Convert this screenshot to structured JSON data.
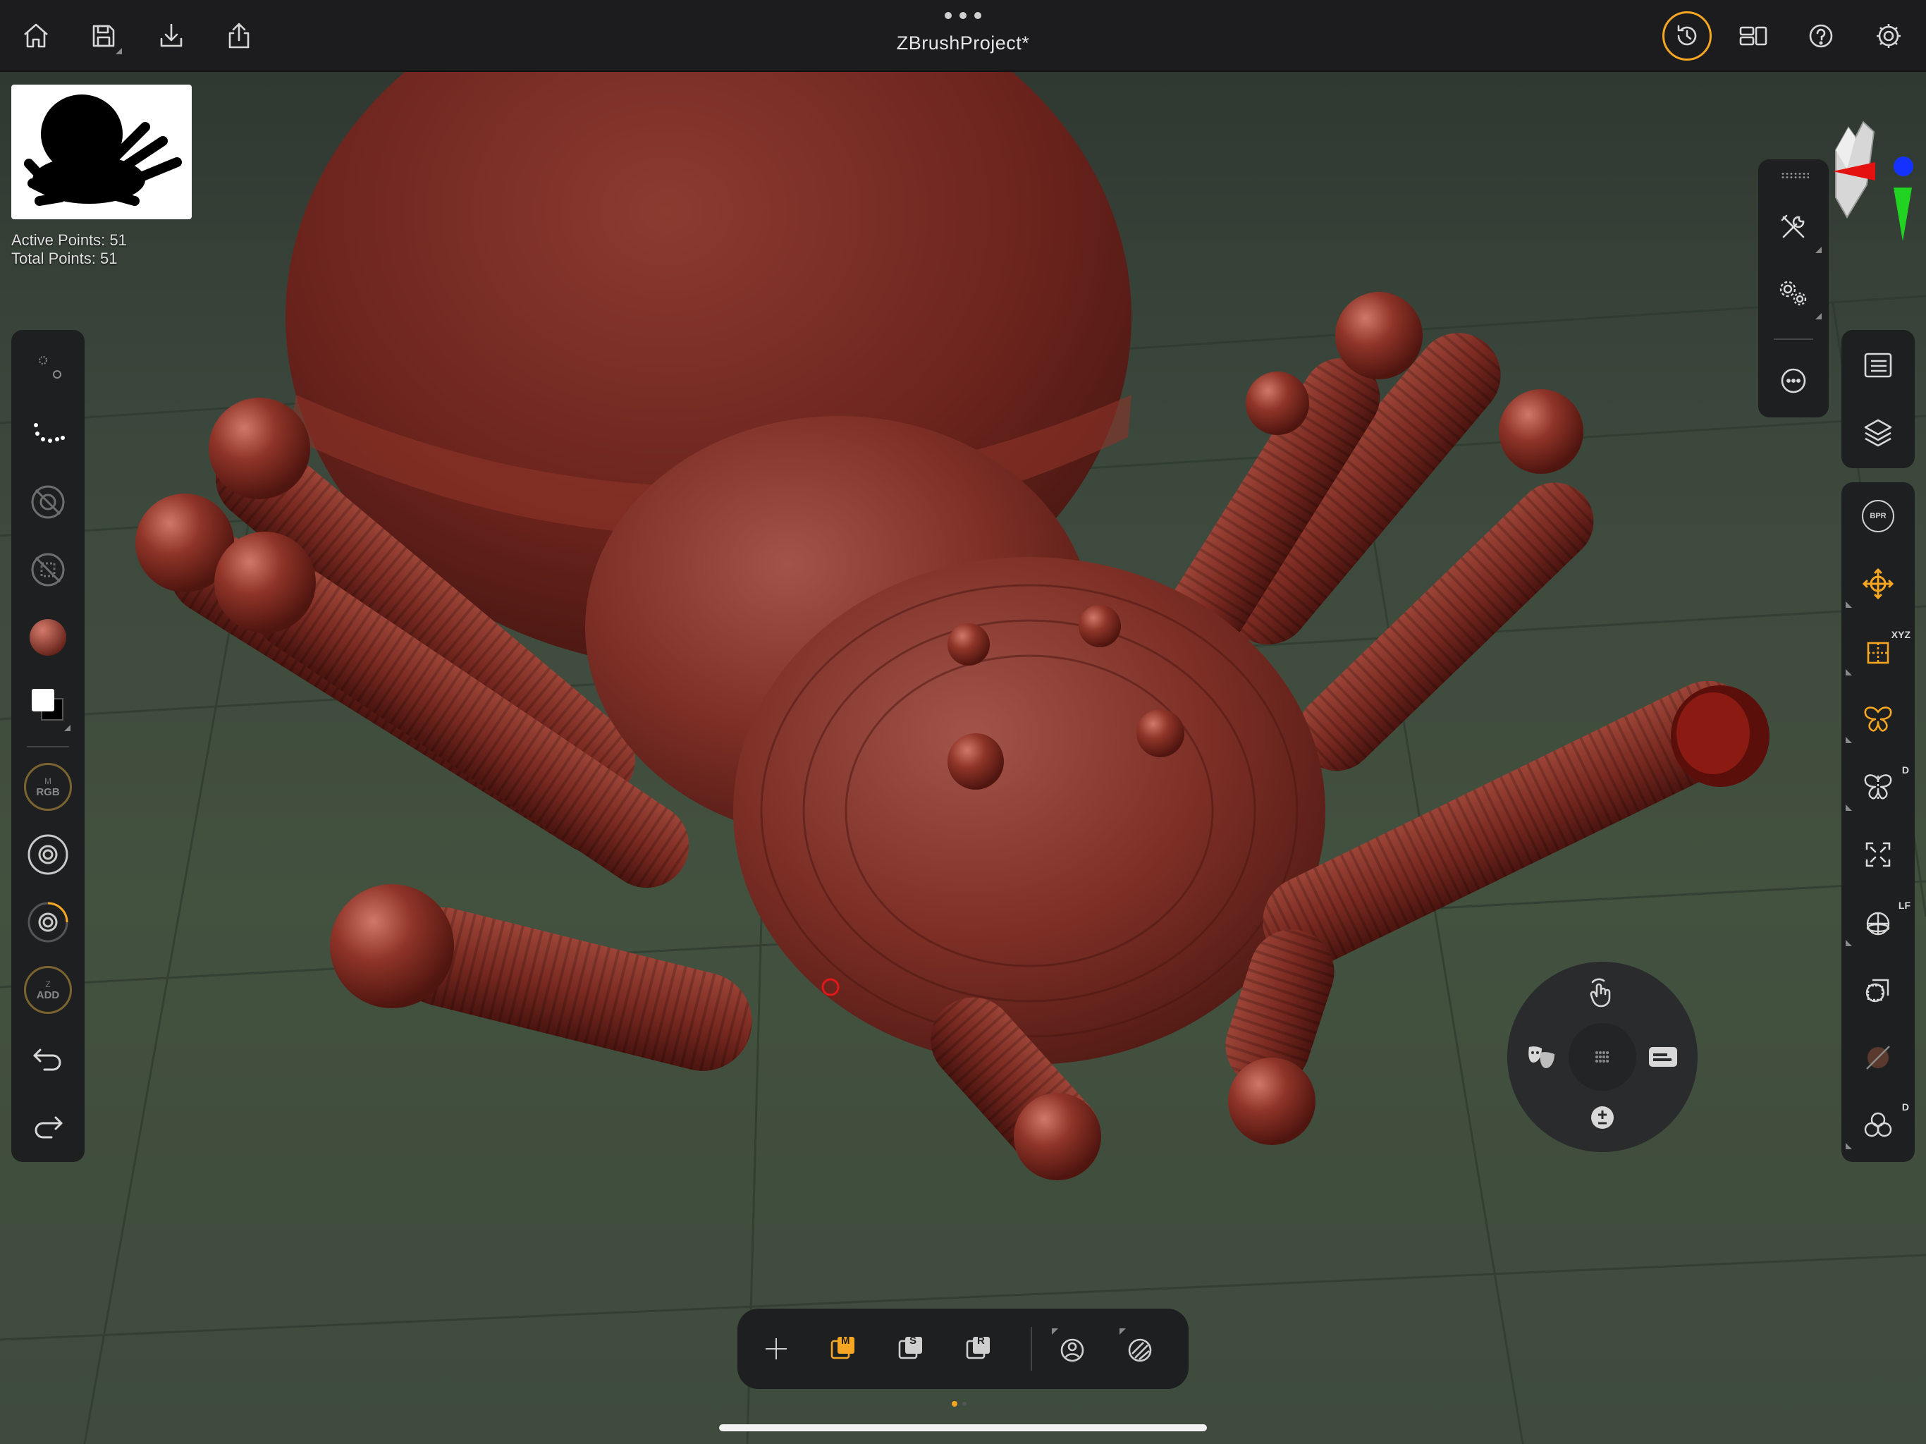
{
  "app": {
    "title": "ZBrushProject*"
  },
  "topbar": {
    "left_icons": [
      "home-icon",
      "save-icon",
      "import-icon",
      "share-icon"
    ],
    "right_icons": [
      "history-icon",
      "layout-icon",
      "help-icon",
      "settings-icon"
    ]
  },
  "thumbnail": {
    "active_points": "Active Points: 51",
    "total_points": "Total Points: 51"
  },
  "left_toolbar": {
    "items": [
      "stroke-dots-icon",
      "stroke-spray-icon",
      "alpha-disabled-icon",
      "texture-disabled-icon",
      "material-sphere-icon",
      "color-swatch-icon",
      "rgb-toggle",
      "focal-shift-icon",
      "draw-size-icon",
      "zadd-toggle",
      "undo-icon",
      "redo-icon"
    ],
    "rgb_top": "M",
    "rgb_label": "RGB",
    "zadd_top": "Z",
    "zadd_label": "ADD"
  },
  "right_tool_panel": {
    "items": [
      "tools-icon",
      "gear-settings-icon",
      "more-icon"
    ]
  },
  "right_panel_top": {
    "items": [
      "list-panel-icon",
      "layers-icon"
    ]
  },
  "right_panel_main": {
    "bpr_label": "BPR",
    "xyz_label": "XYZ",
    "d_label": "D",
    "lf_label": "LF",
    "items": [
      "bpr-render-icon",
      "move-gizmo-icon",
      "symmetry-xyz-icon",
      "symmetry-butterfly-icon",
      "dynamic-symmetry-icon",
      "frame-icon",
      "floor-grid-icon",
      "transparency-icon",
      "solo-icon",
      "dynamic-subdiv-icon"
    ]
  },
  "radial_menu": {
    "items": [
      "gesture-icon",
      "mask-icon",
      "panel-icon",
      "add-sub-icon",
      "grid-dots-icon"
    ]
  },
  "bottom_toolbar": {
    "items": [
      "transform-cross-icon",
      "mrgb-m-icon",
      "s-icon",
      "r-icon",
      "gizmo-icon",
      "polyframe-icon"
    ],
    "m_label": "M",
    "s_label": "S",
    "r_label": "R"
  },
  "colors": {
    "accent": "#f5a623",
    "model": "#7a2b22",
    "axis_x": "#ff1a1a",
    "axis_y": "#2bd42b",
    "axis_z": "#1a3cff"
  }
}
